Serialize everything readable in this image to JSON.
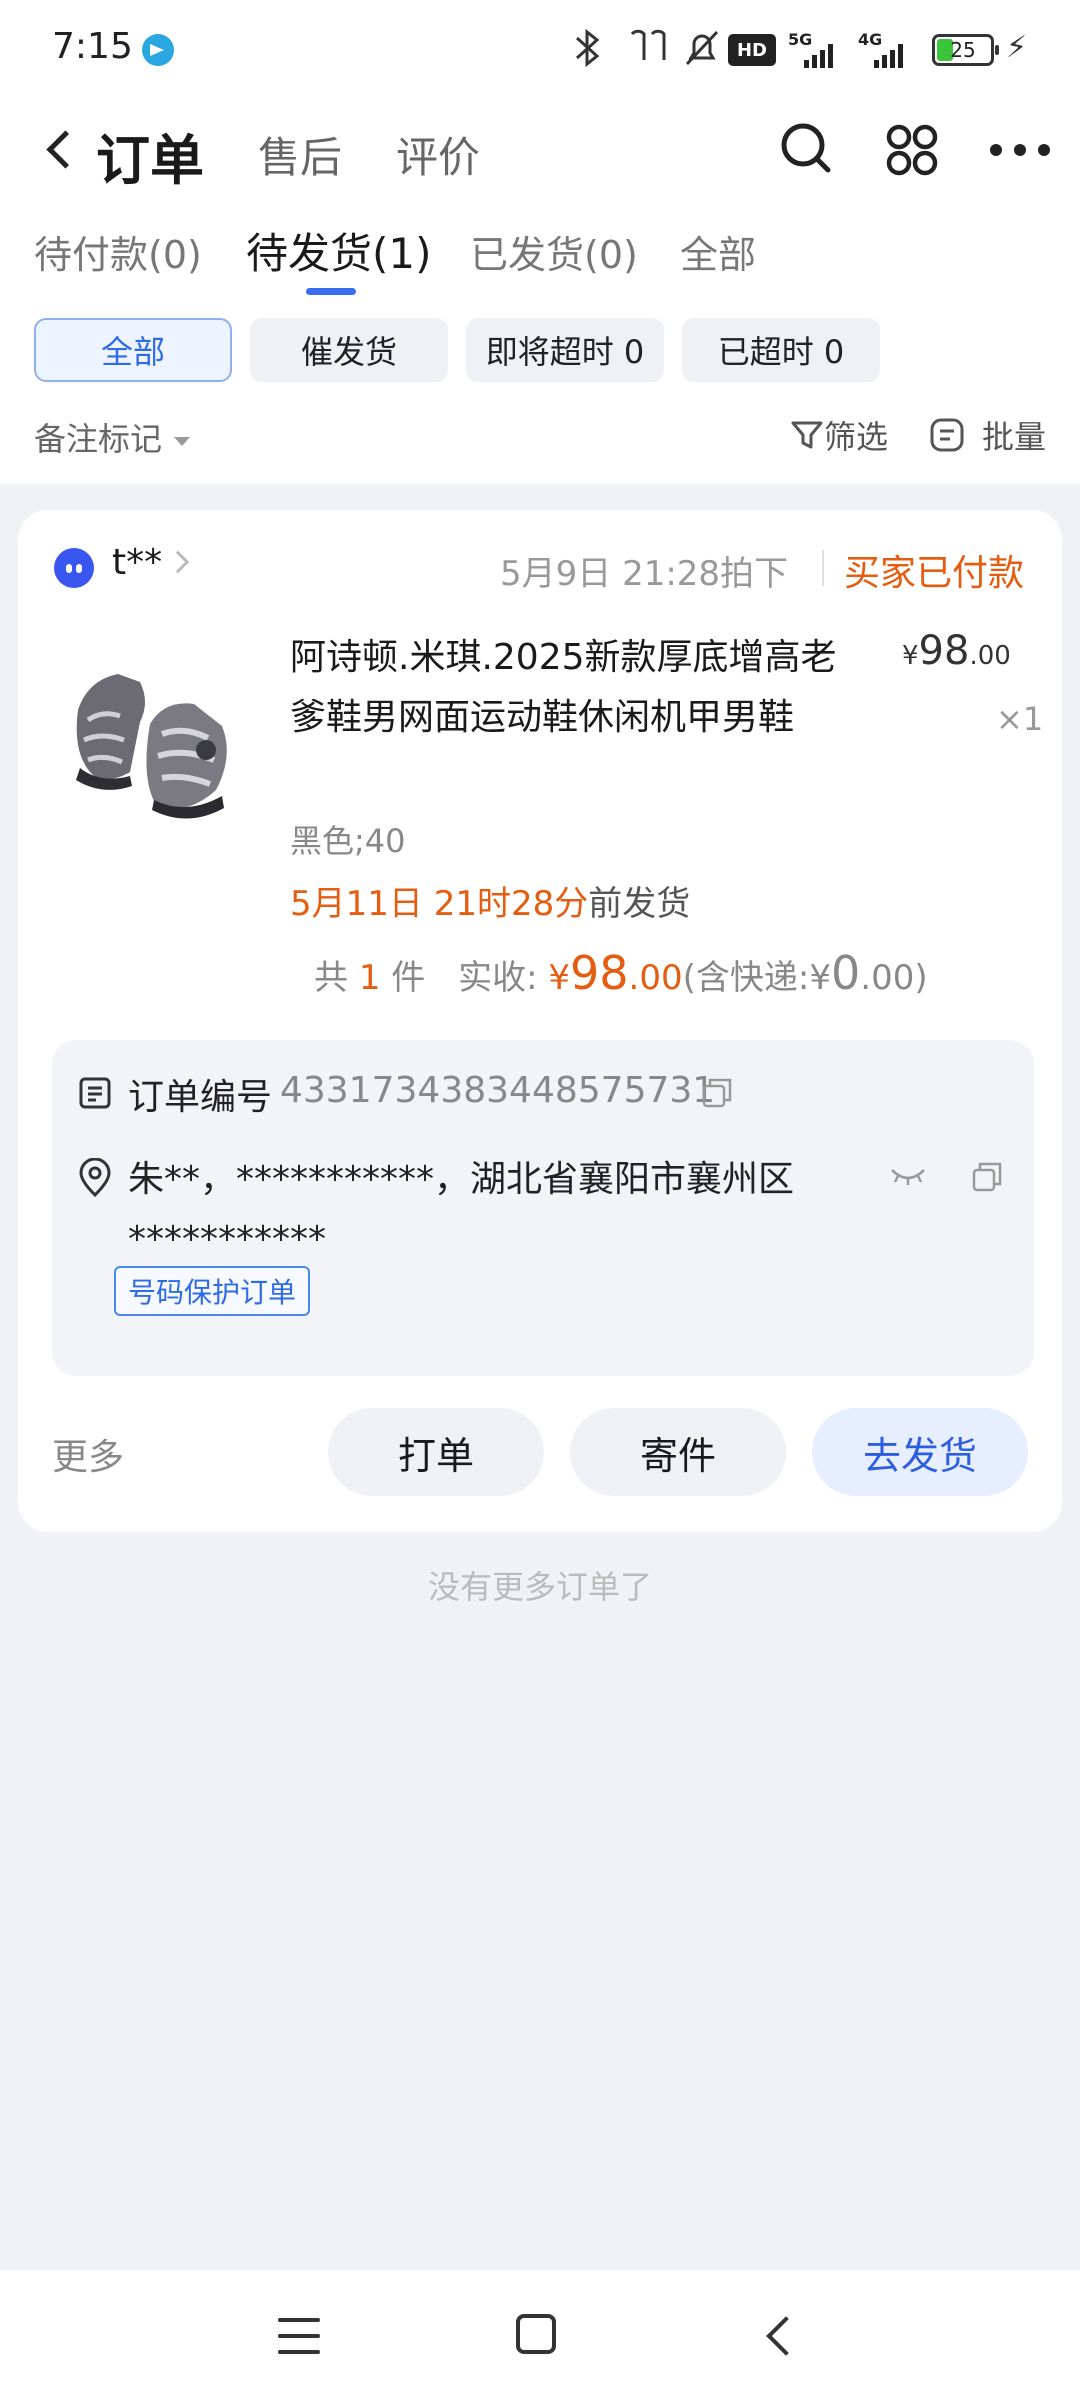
{
  "status_bar": {
    "time": "7:15",
    "hd_label": "HD",
    "net1": "5G",
    "net2": "4G",
    "battery": "25"
  },
  "header": {
    "title": "订单",
    "tabs": [
      "售后",
      "评价"
    ]
  },
  "tabs": [
    {
      "label": "待付款(0)"
    },
    {
      "label": "待发货(1)"
    },
    {
      "label": "已发货(0)"
    },
    {
      "label": "全部"
    }
  ],
  "chips": [
    {
      "label": "全部"
    },
    {
      "label": "催发货"
    },
    {
      "label": "即将超时 0"
    },
    {
      "label": "已超时 0"
    }
  ],
  "toolbar": {
    "remark": "备注标记",
    "filter": "筛选",
    "batch": "批量"
  },
  "order": {
    "buyer": "t**",
    "time": "5月9日 21:28拍下",
    "status": "买家已付款",
    "product_title": "阿诗顿.米琪.2025新款厚底增高老爹鞋男网面运动鞋休闲机甲男鞋",
    "price_symbol": "¥",
    "price_int": "98",
    "price_dec": ".00",
    "qty": "×1",
    "sku": "黑色;40",
    "deadline": "5月11日 21时28分",
    "deadline_suffix": "前发货",
    "summary": {
      "count_prefix": "共",
      "count": "1",
      "count_suffix": "件",
      "received_label": "实收:",
      "received_symbol": "¥",
      "received_int": "98",
      "received_dec": ".00",
      "shipping_prefix": "(含快递:",
      "shipping_symbol": "¥",
      "shipping_int": "0",
      "shipping_dec": ".00)"
    },
    "order_number_label": "订单编号",
    "order_number": "4331734383448575731",
    "address": "朱**，***********，湖北省襄阳市襄州区 ***********",
    "tag": "号码保护订单",
    "more": "更多",
    "actions": [
      "打单",
      "寄件",
      "去发货"
    ]
  },
  "no_more": "没有更多订单了",
  "colors": {
    "accent": "#2e6be6",
    "orange": "#e45d10"
  }
}
